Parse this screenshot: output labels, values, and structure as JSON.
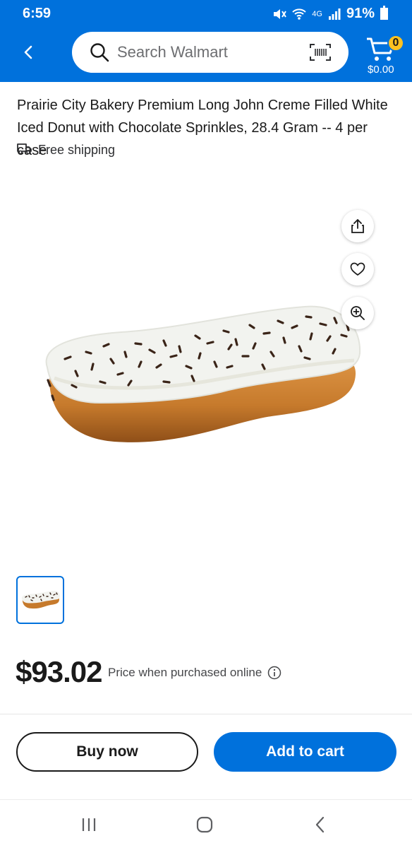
{
  "status_bar": {
    "time": "6:59",
    "network": "4G",
    "battery": "91%"
  },
  "header": {
    "search_placeholder": "Search Walmart",
    "cart_count": "0",
    "cart_total": "$0.00"
  },
  "product": {
    "title": "Prairie City Bakery Premium Long John Creme Filled White Iced Donut with Chocolate Sprinkles, 28.4 Gram -- 4 per case",
    "shipping": "Free shipping",
    "price": "$93.02",
    "price_note": "Price when purchased online"
  },
  "actions": {
    "buy_now": "Buy now",
    "add_to_cart": "Add to cart"
  },
  "icons": {
    "back": "chevron-left-icon",
    "search": "search-icon",
    "barcode": "barcode-icon",
    "cart": "cart-icon",
    "shipping": "truck-icon",
    "share": "share-icon",
    "favorite": "heart-icon",
    "zoom": "zoom-in-icon",
    "info": "info-icon"
  },
  "colors": {
    "brand_blue": "#0071dc",
    "badge_yellow": "#ffc220"
  }
}
